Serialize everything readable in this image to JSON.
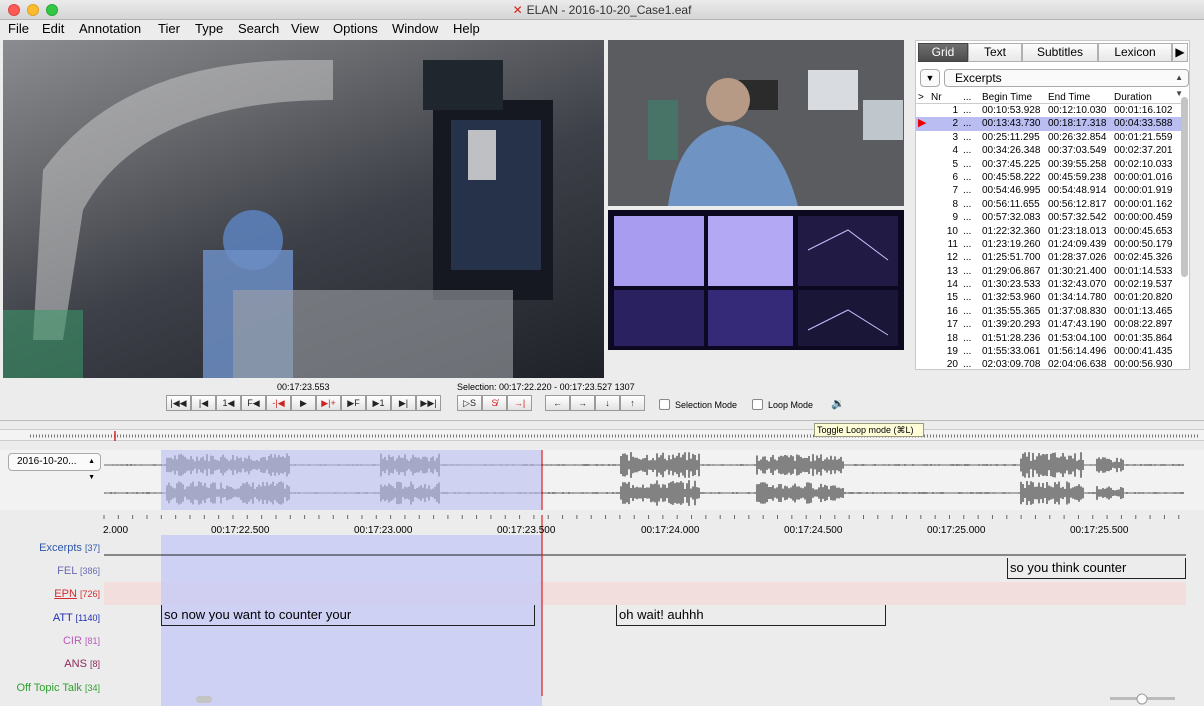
{
  "window": {
    "title": "ELAN - 2016-10-20_Case1.eaf",
    "app_icon": "elan-icon"
  },
  "menu": [
    "File",
    "Edit",
    "Annotation",
    "Tier",
    "Type",
    "Search",
    "View",
    "Options",
    "Window",
    "Help"
  ],
  "side_panel": {
    "tabs": [
      "Grid",
      "Text",
      "Subtitles",
      "Lexicon"
    ],
    "active_tab": "Grid",
    "tier_dropdown": "Excerpts",
    "grid_columns": [
      ">",
      "Nr",
      "...",
      "Begin Time",
      "End Time",
      "Duration"
    ],
    "rows": [
      {
        "nr": "1",
        "dots": "...",
        "begin": "00:10:53.928",
        "end": "00:12:10.030",
        "duration": "00:01:16.102"
      },
      {
        "nr": "2",
        "dots": "...",
        "begin": "00:13:43.730",
        "end": "00:18:17.318",
        "duration": "00:04:33.588"
      },
      {
        "nr": "3",
        "dots": "...",
        "begin": "00:25:11.295",
        "end": "00:26:32.854",
        "duration": "00:01:21.559"
      },
      {
        "nr": "4",
        "dots": "...",
        "begin": "00:34:26.348",
        "end": "00:37:03.549",
        "duration": "00:02:37.201"
      },
      {
        "nr": "5",
        "dots": "...",
        "begin": "00:37:45.225",
        "end": "00:39:55.258",
        "duration": "00:02:10.033"
      },
      {
        "nr": "6",
        "dots": "...",
        "begin": "00:45:58.222",
        "end": "00:45:59.238",
        "duration": "00:00:01.016"
      },
      {
        "nr": "7",
        "dots": "...",
        "begin": "00:54:46.995",
        "end": "00:54:48.914",
        "duration": "00:00:01.919"
      },
      {
        "nr": "8",
        "dots": "...",
        "begin": "00:56:11.655",
        "end": "00:56:12.817",
        "duration": "00:00:01.162"
      },
      {
        "nr": "9",
        "dots": "...",
        "begin": "00:57:32.083",
        "end": "00:57:32.542",
        "duration": "00:00:00.459"
      },
      {
        "nr": "10",
        "dots": "...",
        "begin": "01:22:32.360",
        "end": "01:23:18.013",
        "duration": "00:00:45.653"
      },
      {
        "nr": "11",
        "dots": "...",
        "begin": "01:23:19.260",
        "end": "01:24:09.439",
        "duration": "00:00:50.179"
      },
      {
        "nr": "12",
        "dots": "...",
        "begin": "01:25:51.700",
        "end": "01:28:37.026",
        "duration": "00:02:45.326"
      },
      {
        "nr": "13",
        "dots": "...",
        "begin": "01:29:06.867",
        "end": "01:30:21.400",
        "duration": "00:01:14.533"
      },
      {
        "nr": "14",
        "dots": "...",
        "begin": "01:30:23.533",
        "end": "01:32:43.070",
        "duration": "00:02:19.537"
      },
      {
        "nr": "15",
        "dots": "...",
        "begin": "01:32:53.960",
        "end": "01:34:14.780",
        "duration": "00:01:20.820"
      },
      {
        "nr": "16",
        "dots": "...",
        "begin": "01:35:55.365",
        "end": "01:37:08.830",
        "duration": "00:01:13.465"
      },
      {
        "nr": "17",
        "dots": "...",
        "begin": "01:39:20.293",
        "end": "01:47:43.190",
        "duration": "00:08:22.897"
      },
      {
        "nr": "18",
        "dots": "...",
        "begin": "01:51:28.236",
        "end": "01:53:04.100",
        "duration": "00:01:35.864"
      },
      {
        "nr": "19",
        "dots": "...",
        "begin": "01:55:33.061",
        "end": "01:56:14.496",
        "duration": "00:00:41.435"
      },
      {
        "nr": "20",
        "dots": "...",
        "begin": "02:03:09.708",
        "end": "02:04:06.638",
        "duration": "00:00:56.930"
      }
    ]
  },
  "media_controls": {
    "current_time": "00:17:23.553",
    "selection": "Selection: 00:17:22.220 - 00:17:23.527  1307",
    "player_buttons": [
      "|◀◀",
      "|◀",
      "1◀",
      "F◀",
      "-|◀",
      "▶",
      "▶|+",
      "▶F",
      "▶1",
      "▶|",
      "▶▶|"
    ],
    "selection_buttons": [
      "▷S",
      "S̸",
      "→|"
    ],
    "nav_buttons": [
      "←",
      "→",
      "↓",
      "↑"
    ],
    "selection_mode_label": "Selection Mode",
    "loop_mode_label": "Loop Mode",
    "volume_icon": "speaker-icon",
    "tooltip": "Toggle Loop mode (⌘L)"
  },
  "waveform": {
    "file_select": "2016-10-20..."
  },
  "ruler": {
    "ticks": [
      "2.000",
      "00:17:22.500",
      "00:17:23.000",
      "00:17:23.500",
      "00:17:24.000",
      "00:17:24.500",
      "00:17:25.000",
      "00:17:25.500"
    ]
  },
  "tiers": [
    {
      "name": "Excerpts",
      "count": "[37]",
      "color": "#2f58a8"
    },
    {
      "name": "FEL",
      "count": "[386]",
      "color": "#6b6bb4"
    },
    {
      "name": "EPN",
      "count": "[726]",
      "color": "#d32d2d"
    },
    {
      "name": "ATT",
      "count": "[1140]",
      "color": "#1f2fb0"
    },
    {
      "name": "CIR",
      "count": "[81]",
      "color": "#b85ab8"
    },
    {
      "name": "ANS",
      "count": "[8]",
      "color": "#8a2a5a"
    },
    {
      "name": "Off Topic Talk",
      "count": "[34]",
      "color": "#2fa02f"
    }
  ],
  "annotations": {
    "fel_1": "so you think counter",
    "att_1": "so now you want to counter your",
    "att_2": "oh wait! auhhh"
  },
  "colors": {
    "selection": "#b9bdf2",
    "crosshair": "#e02020",
    "epn_band": "#f3dede"
  }
}
